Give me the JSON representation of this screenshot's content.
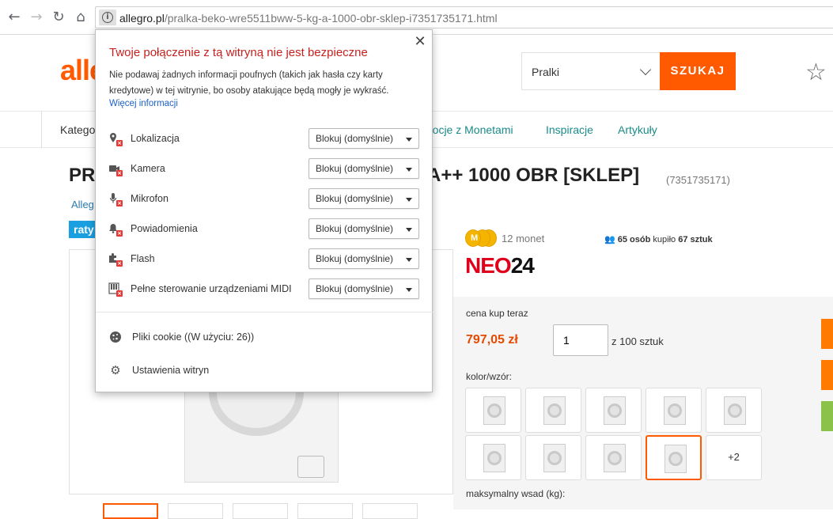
{
  "browser": {
    "back_icon": "arrow-left-icon",
    "url_host": "allegro.pl",
    "url_path": "/pralka-beko-wre5511bww-5-kg-a-1000-obr-sklep-i7351735171.html"
  },
  "site": {
    "logo": "alle",
    "category_select": "Pralki",
    "search_button": "SZUKAJ",
    "nav": {
      "kategorie": "Katego",
      "monety": "mocje z Monetami",
      "inspiracje": "Inspiracje",
      "artykuly": "Artykuły"
    }
  },
  "product": {
    "title_prefix": "PR",
    "title_suffix": "A++ 1000 OBR [SKLEP]",
    "offer_id": "(7351735171)",
    "breadcrumb": "Alleg",
    "raty_badge": "raty",
    "coins": "12 monet",
    "coin_letter": "M",
    "bought_people": "65 osób",
    "bought_mid": "kupiło",
    "bought_count": "67 sztuk",
    "seller_red": "NEO",
    "seller_black": "24",
    "price_label": "cena kup teraz",
    "price": "797,05 zł",
    "quantity": "1",
    "quantity_of": "z 100 sztuk",
    "color_label": "kolor/wzór:",
    "more_variants": "+2",
    "load_label": "maksymalny wsad (kg):"
  },
  "popup": {
    "title": "Twoje połączenie z tą witryną nie jest bezpieczne",
    "close": "✕",
    "description": "Nie podawaj żadnych informacji poufnych (takich jak hasła czy karty kredytowe) w tej witrynie, bo osoby atakujące będą mogły je wykraść.",
    "more_info": "Więcej informacji",
    "permissions": [
      {
        "label": "Lokalizacja",
        "value": "Blokuj (domyślnie)",
        "icon": "location-blocked-icon"
      },
      {
        "label": "Kamera",
        "value": "Blokuj (domyślnie)",
        "icon": "camera-blocked-icon"
      },
      {
        "label": "Mikrofon",
        "value": "Blokuj (domyślnie)",
        "icon": "microphone-blocked-icon"
      },
      {
        "label": "Powiadomienia",
        "value": "Blokuj (domyślnie)",
        "icon": "notifications-blocked-icon"
      },
      {
        "label": "Flash",
        "value": "Blokuj (domyślnie)",
        "icon": "flash-plugin-blocked-icon"
      },
      {
        "label": "Pełne sterowanie urządzeniami MIDI",
        "value": "Blokuj (domyślnie)",
        "icon": "midi-blocked-icon"
      }
    ],
    "cookies": "Pliki cookie ((W użyciu: 26))",
    "site_settings": "Ustawienia witryn"
  }
}
